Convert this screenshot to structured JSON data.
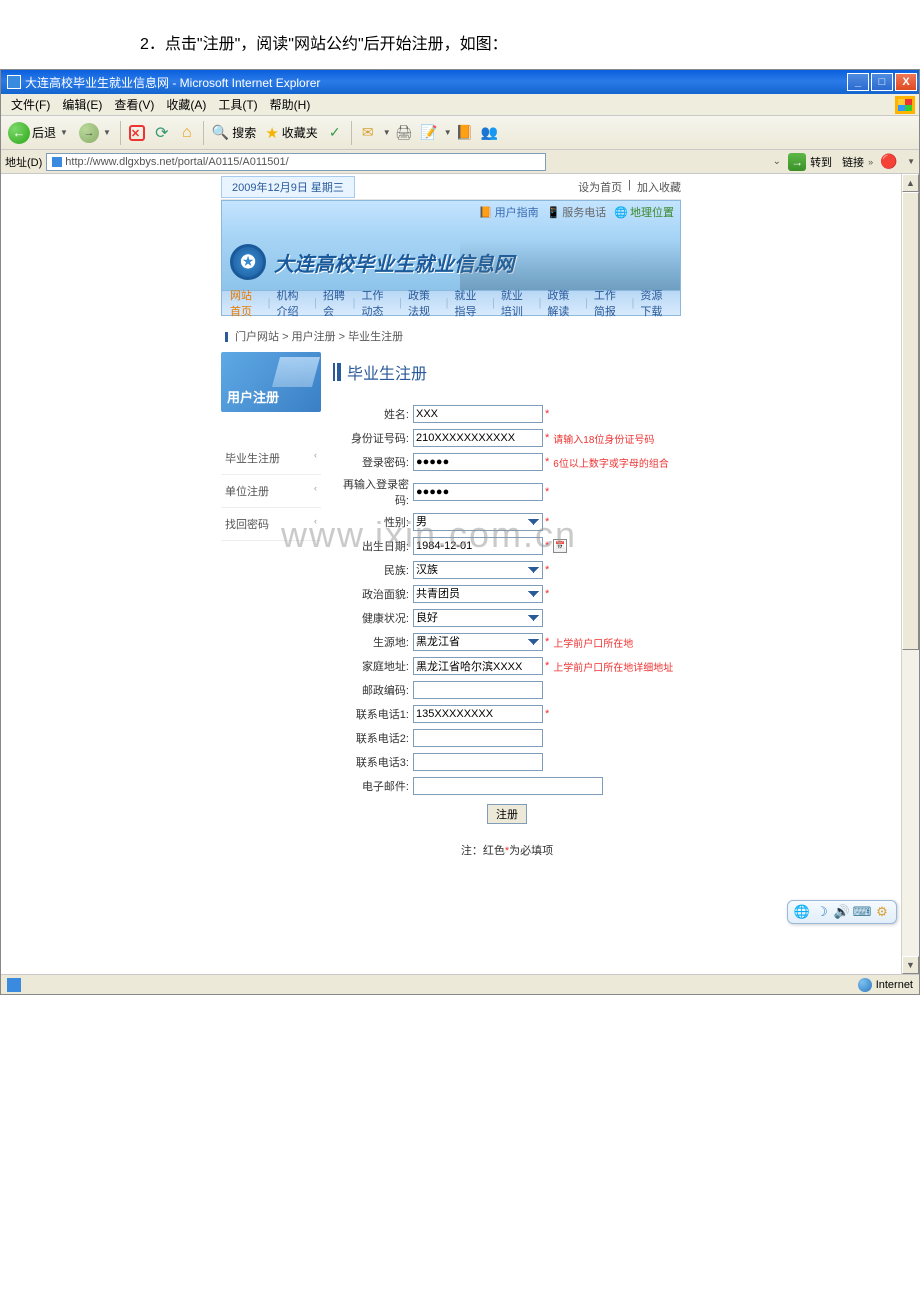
{
  "doc": {
    "instruction": "2．点击\"注册\"，阅读\"网站公约\"后开始注册，如图："
  },
  "titlebar": {
    "text": "大连高校毕业生就业信息网 - Microsoft Internet Explorer",
    "min": "_",
    "max": "□",
    "close": "X"
  },
  "menubar": {
    "file": "文件(F)",
    "edit": "编辑(E)",
    "view": "查看(V)",
    "fav": "收藏(A)",
    "tools": "工具(T)",
    "help": "帮助(H)"
  },
  "toolbar": {
    "back": "后退",
    "search": "搜索",
    "fav": "收藏夹"
  },
  "addrbar": {
    "label": "地址(D)",
    "url": "http://www.dlgxbys.net/portal/A0115/A011501/",
    "go": "转到",
    "links": "链接"
  },
  "page": {
    "date": "2009年12月9日 星期三",
    "set_home": "设为首页",
    "add_fav": "加入收藏",
    "header_links": {
      "guide": "用户指南",
      "phone": "服务电话",
      "location": "地理位置"
    },
    "site_title": "大连高校毕业生就业信息网",
    "nav": {
      "home": "网站首页",
      "org": "机构介绍",
      "jobfair": "招聘会",
      "work": "工作动态",
      "policy": "政策法规",
      "guide": "就业指导",
      "train": "就业培训",
      "interpret": "政策解读",
      "report": "工作简报",
      "download": "资源下载"
    },
    "breadcrumb": {
      "portal": "门户网站",
      "reg": "用户注册",
      "grad": "毕业生注册"
    },
    "sidebar": {
      "card": "用户注册",
      "item1": "毕业生注册",
      "item2": "单位注册",
      "item3": "找回密码"
    },
    "form": {
      "title": "毕业生注册",
      "labels": {
        "name": "姓名:",
        "id": "身份证号码:",
        "pwd": "登录密码:",
        "pwd2": "再输入登录密码:",
        "gender": "性别:",
        "birth": "出生日期:",
        "ethnic": "民族:",
        "political": "政治面貌:",
        "health": "健康状况:",
        "origin": "生源地:",
        "home": "家庭地址:",
        "zip": "邮政编码:",
        "phone1": "联系电话1:",
        "phone2": "联系电话2:",
        "phone3": "联系电话3:",
        "email": "电子邮件:"
      },
      "values": {
        "name": "XXX",
        "id": "210XXXXXXXXXXX",
        "pwd": "●●●●●",
        "pwd2": "●●●●●",
        "gender": "男",
        "birth": "1984-12-01",
        "ethnic": "汉族",
        "political": "共青团员",
        "health": "良好",
        "origin": "黑龙江省",
        "home": "黑龙江省哈尔滨XXXX",
        "phone1": "135XXXXXXXX"
      },
      "hints": {
        "id": "请输入18位身份证号码",
        "pwd": "6位以上数字或字母的组合",
        "origin": "上学前户口所在地",
        "home": "上学前户口所在地详细地址"
      },
      "submit": "注册",
      "note_prefix": "注：红色",
      "note_star": "*",
      "note_suffix": "为必填项"
    }
  },
  "watermark": "www.ixin.com.cn",
  "statusbar": {
    "zone": "Internet"
  }
}
